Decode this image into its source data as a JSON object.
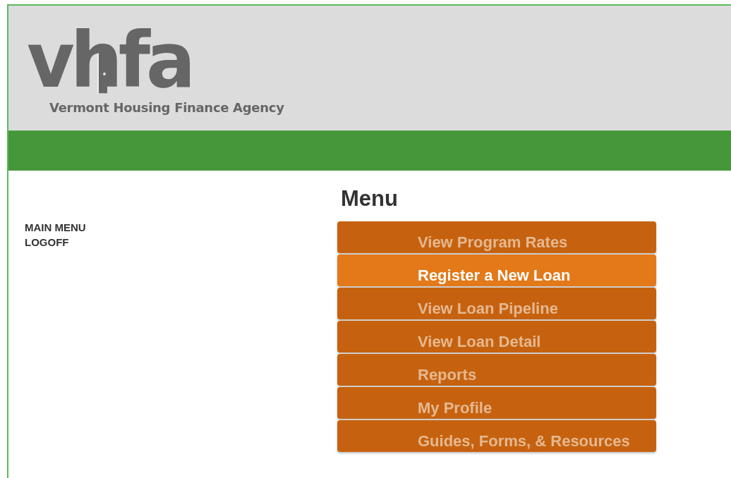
{
  "logo": {
    "wordmark": "vhfa",
    "tagline": "Vermont Housing Finance Agency"
  },
  "sidebar": {
    "items": [
      {
        "label": "MAIN MENU"
      },
      {
        "label": "LOGOFF"
      }
    ]
  },
  "menu": {
    "title": "Menu",
    "items": [
      {
        "label": "View Program Rates",
        "selected": false
      },
      {
        "label": "Register a New Loan",
        "selected": true
      },
      {
        "label": "View Loan Pipeline",
        "selected": false
      },
      {
        "label": "View Loan Detail",
        "selected": false
      },
      {
        "label": "Reports",
        "selected": false
      },
      {
        "label": "My Profile",
        "selected": false
      },
      {
        "label": "Guides, Forms, & Resources",
        "selected": false
      }
    ]
  }
}
